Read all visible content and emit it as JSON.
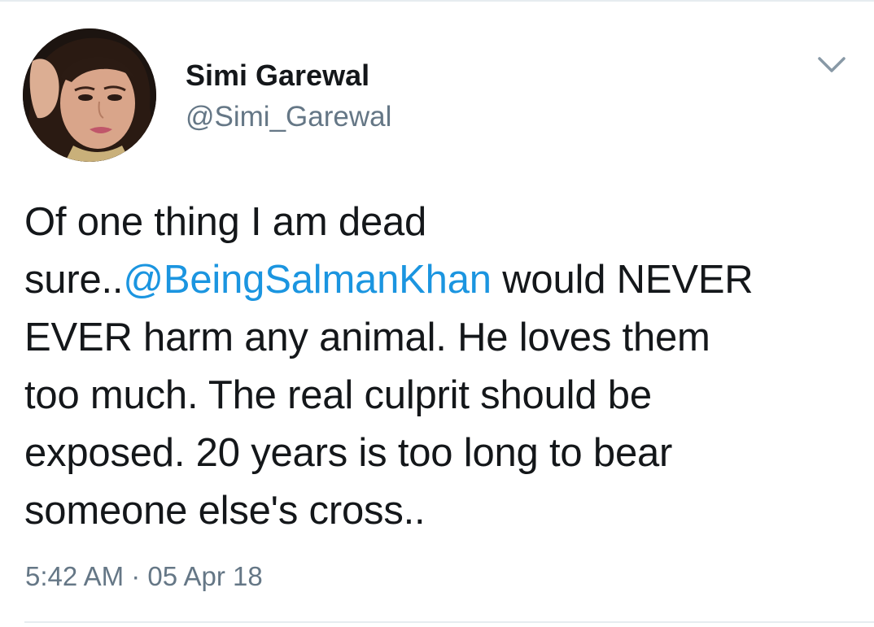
{
  "author": {
    "display_name": "Simi Garewal",
    "handle": "@Simi_Garewal",
    "avatar_icon": "profile-photo"
  },
  "menu": {
    "caret_icon": "chevron-down-icon"
  },
  "tweet": {
    "lines": [
      {
        "segments": [
          {
            "text": "Of one thing I am dead",
            "type": "text"
          }
        ]
      },
      {
        "segments": [
          {
            "text": "sure..",
            "type": "text"
          },
          {
            "text": "@BeingSalmanKhan",
            "type": "mention"
          },
          {
            "text": " would NEVER",
            "type": "text"
          }
        ]
      },
      {
        "segments": [
          {
            "text": "EVER harm any animal. He loves them",
            "type": "text"
          }
        ]
      },
      {
        "segments": [
          {
            "text": "too much. The real culprit should be",
            "type": "text"
          }
        ]
      },
      {
        "segments": [
          {
            "text": "exposed. 20 years is too long to bear",
            "type": "text"
          }
        ]
      },
      {
        "segments": [
          {
            "text": "someone else's cross..",
            "type": "text"
          }
        ]
      }
    ],
    "timestamp": "5:42 AM · 05 Apr 18"
  },
  "colors": {
    "mention": "#1b95e0",
    "secondary_text": "#657786",
    "primary_text": "#14171a",
    "divider": "#e6ecf0"
  }
}
